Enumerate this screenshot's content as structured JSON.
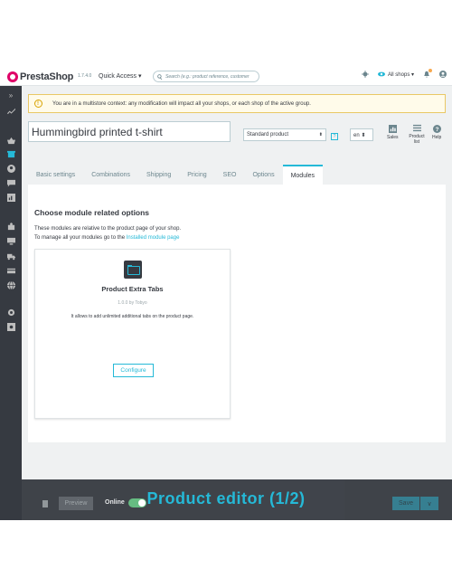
{
  "header": {
    "brand": "PrestaShop",
    "version": "1.7.4.0",
    "quick_access": "Quick Access ▾",
    "search_placeholder": "Search (e.g.: product reference, customer",
    "shop_selector": "All shops ▾"
  },
  "alert": {
    "icon": "!",
    "text": "You are in a multistore context: any modification will impact all your shops, or each shop of the active group."
  },
  "product": {
    "name": "Hummingbird printed t-shirt",
    "type": "Standard product",
    "type_caret": "⬍",
    "help_mark": "?",
    "language": "en ⬍"
  },
  "toolbar": {
    "sales": "Sales",
    "product_list": "Product list",
    "help": "Help"
  },
  "tabs": [
    "Basic settings",
    "Combinations",
    "Shipping",
    "Pricing",
    "SEO",
    "Options",
    "Modules"
  ],
  "active_tab": "Modules",
  "modules_panel": {
    "title": "Choose module related options",
    "line1": "These modules are relative to the product page of your shop.",
    "line2_prefix": "To manage all your modules go to the ",
    "line2_link": "Installed module page"
  },
  "module_card": {
    "icon": "module-tabs-icon",
    "name": "Product Extra Tabs",
    "version": "1.0.0 by Tobyo",
    "description": "It allows to add unlimited additional tabs on the product page.",
    "configure_label": "Configure"
  },
  "footer": {
    "preview_label": "Preview",
    "online_label": "Online",
    "save_label": "Save",
    "save_caret": "∨"
  },
  "caption": "Product editor (1/2)",
  "colors": {
    "accent": "#25b9d7",
    "sidebar": "#363a41",
    "alert_border": "#e9c865",
    "online_toggle": "#5fba7d"
  }
}
